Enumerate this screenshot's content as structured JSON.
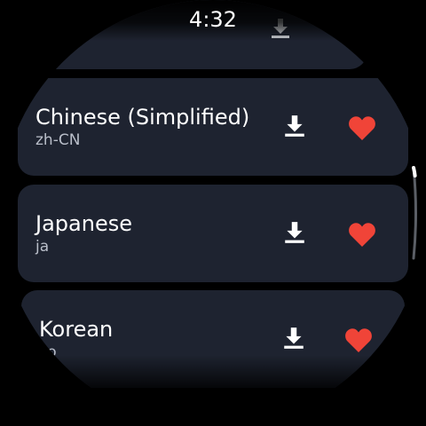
{
  "status": {
    "time": "4:32"
  },
  "colors": {
    "card_bg": "#1e2330",
    "heart": "#f04438",
    "icon": "#ffffff",
    "subtitle": "#b9bec9"
  },
  "languages": [
    {
      "name": "",
      "code": "",
      "download_icon": "download-icon",
      "favorite": false
    },
    {
      "name": "Chinese (Simplified)",
      "code": "zh-CN",
      "download_icon": "download-icon",
      "favorite": true,
      "favorite_icon": "heart-icon"
    },
    {
      "name": "Japanese",
      "code": "ja",
      "download_icon": "download-icon",
      "favorite": true,
      "favorite_icon": "heart-icon"
    },
    {
      "name": "Korean",
      "code": "ko",
      "download_icon": "download-icon",
      "favorite": true,
      "favorite_icon": "heart-icon"
    }
  ]
}
